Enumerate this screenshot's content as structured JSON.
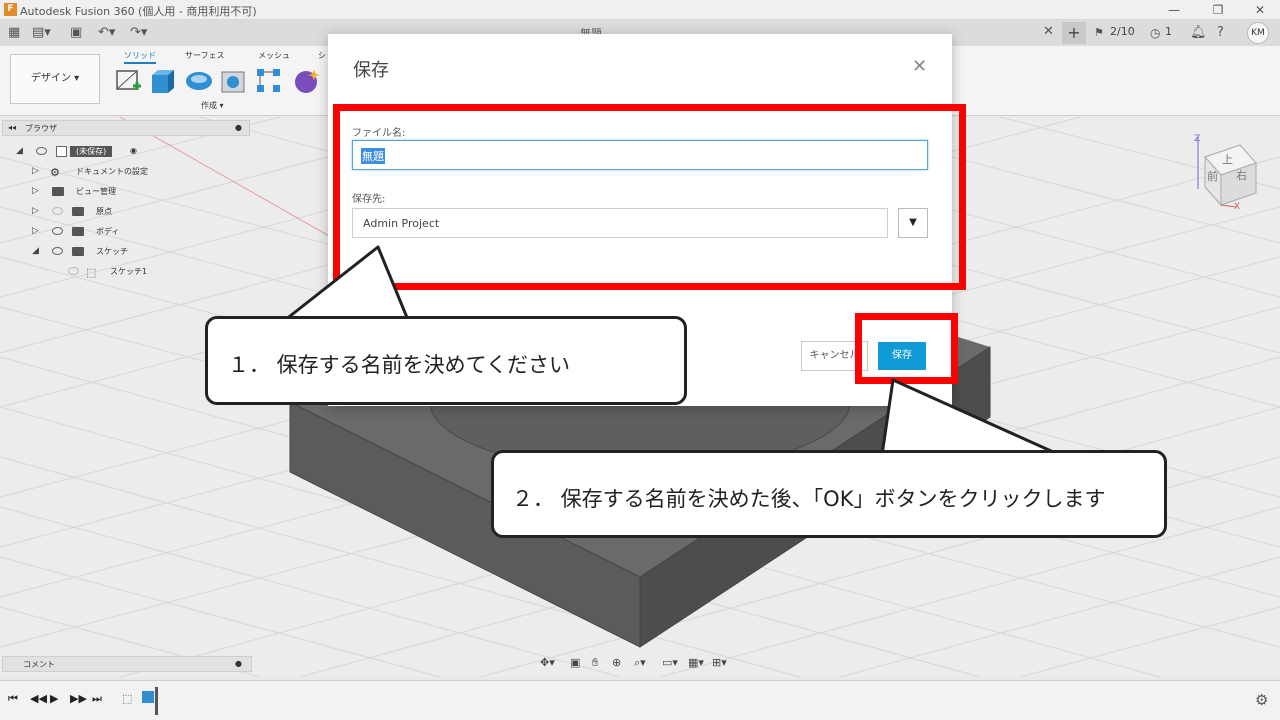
{
  "window": {
    "app_icon": "F",
    "title": "Autodesk Fusion 360 (個人用 - 商用利用不可)",
    "minimize": "—",
    "restore": "❐",
    "close": "✕"
  },
  "appbar": {
    "doc_tab_label": "無題",
    "tab_close": "✕",
    "tab_add": "+",
    "jobs": "2/10",
    "online": "1",
    "avatar": "KM",
    "icons": [
      "grid-icon",
      "file-icon",
      "save-icon",
      "undo-icon",
      "redo-icon",
      "jobs-icon",
      "clock-icon",
      "bell-icon",
      "help-icon"
    ]
  },
  "toolbar": {
    "workspace_button": "デザイン ▾",
    "tabs": [
      "ソリッド",
      "サーフェス",
      "メッシュ",
      "シ"
    ],
    "create_label": "作成 ▾"
  },
  "browser": {
    "header": "ブラウザ",
    "items": [
      {
        "label": "(未保存)"
      },
      {
        "label": "ドキュメントの設定"
      },
      {
        "label": "ビュー管理"
      },
      {
        "label": "原点"
      },
      {
        "label": "ボディ"
      },
      {
        "label": "スケッチ"
      },
      {
        "label": "スケッチ1"
      }
    ]
  },
  "comments": {
    "label": "コメント"
  },
  "viewcube": {
    "top": "上",
    "front": "前",
    "right": "右",
    "z": "Z",
    "x": "X"
  },
  "dialog": {
    "title": "保存",
    "close": "✕",
    "filename_label": "ファイル名:",
    "filename_value": "無題",
    "location_label": "保存先:",
    "location_value": "Admin Project",
    "dropdown_arrow": "▼",
    "cancel": "キャンセル",
    "save": "保存"
  },
  "callouts": {
    "step1": "１． 保存する名前を決めてください",
    "step2": "２． 保存する名前を決めた後、「OK」ボタンをクリックします"
  },
  "colors": {
    "highlight": "#ff0000",
    "save_button": "#109bd7",
    "model": "#5b5b5b"
  }
}
